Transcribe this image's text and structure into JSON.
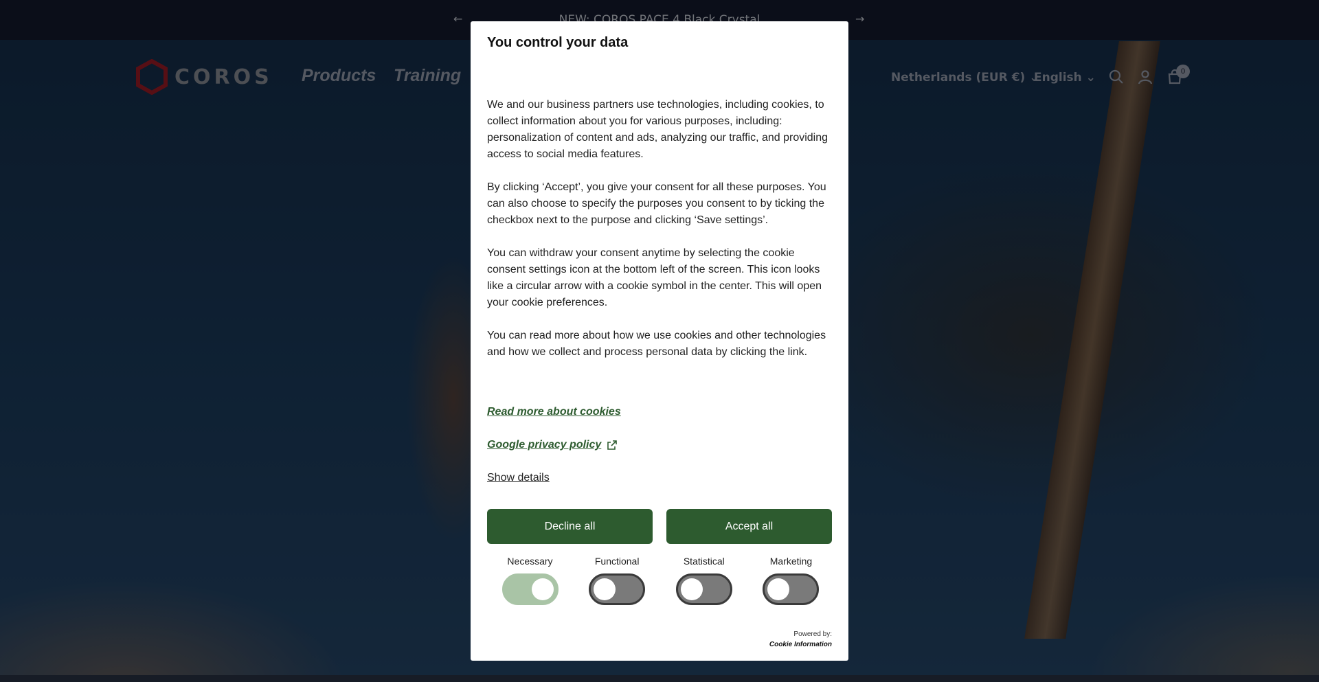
{
  "announcement": {
    "text": "NEW: COROS PACE 4 Black Crystal"
  },
  "header": {
    "logo_text": "COROS",
    "nav": {
      "products": "Products",
      "training": "Training"
    },
    "region": "Netherlands (EUR €)",
    "language": "English",
    "cart_count": "0"
  },
  "consent": {
    "title": "You control your data",
    "paragraphs": [
      "We and our business partners use technologies, including cookies, to collect information about you for various purposes, including: personalization of content and ads, analyzing our traffic, and providing access to social media features.",
      "By clicking ‘Accept’, you give your consent for all these purposes. You can also choose to specify the purposes you consent to by ticking the checkbox next to the purpose and clicking ‘Save settings’.",
      "You can withdraw your consent anytime by selecting the cookie consent settings icon at the bottom left of the screen. This icon looks like a circular arrow with a cookie symbol in the center. This will open your cookie preferences.",
      "You can read more about how we use cookies and other technologies and how we collect and process personal data by clicking the link."
    ],
    "read_more_link": "Read more about cookies",
    "privacy_link": "Google privacy policy",
    "show_details": "Show details",
    "decline_label": "Decline all",
    "accept_label": "Accept all",
    "toggles": [
      {
        "label": "Necessary",
        "on": true
      },
      {
        "label": "Functional",
        "on": false
      },
      {
        "label": "Statistical",
        "on": false
      },
      {
        "label": "Marketing",
        "on": false
      }
    ],
    "powered_by": "Powered by:",
    "powered_brand": "Cookie Information",
    "accent_color": "#2d5b2f"
  }
}
